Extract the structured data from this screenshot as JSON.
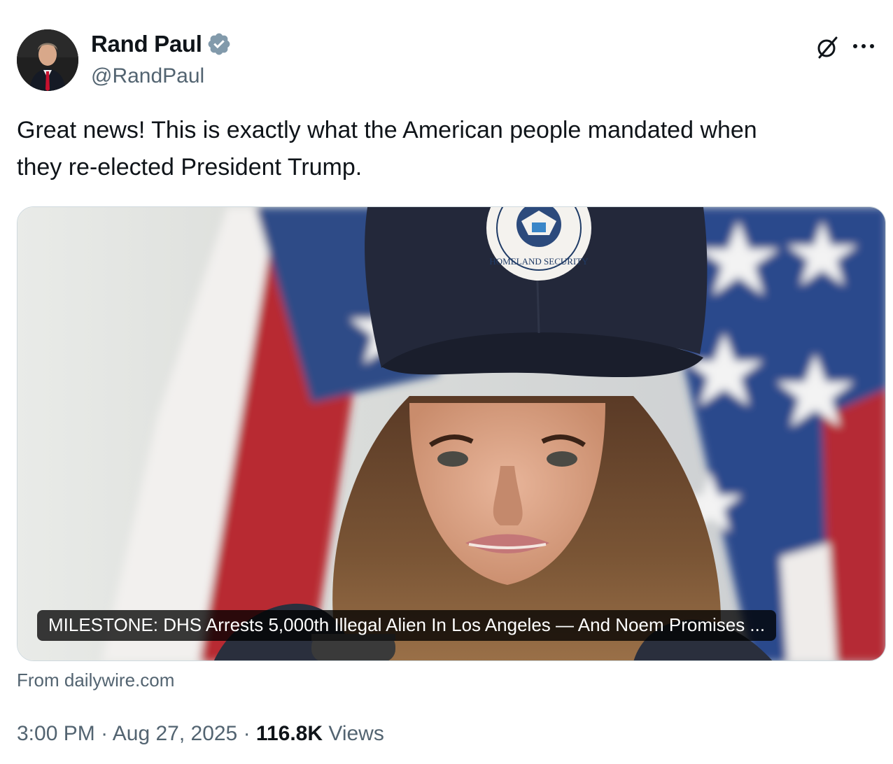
{
  "author": {
    "name": "Rand Paul",
    "handle": "@RandPaul",
    "verified": true,
    "avatar_icon": "avatar"
  },
  "icons": {
    "verified": "verified-badge-icon",
    "grok": "grok-icon",
    "more": "more-icon"
  },
  "tweet": {
    "text_line1": "Great news! This is exactly what the American people mandated when",
    "text_line2": "they re-elected President Trump."
  },
  "card": {
    "headline": "MILESTONE: DHS Arrests 5,000th Illegal Alien In Los Angeles — And Noem Promises ...",
    "cap_seal_text": "HOMELAND SECURITY",
    "source": "From dailywire.com"
  },
  "meta": {
    "time": "3:00 PM",
    "sep1": " · ",
    "date": "Aug 27, 2025",
    "sep2": " · ",
    "views_count": "116.8K",
    "views_label": " Views"
  },
  "colors": {
    "text": "#0f1419",
    "secondary": "#536471",
    "verified_badge": "#829aab",
    "border": "#cfd9de"
  }
}
